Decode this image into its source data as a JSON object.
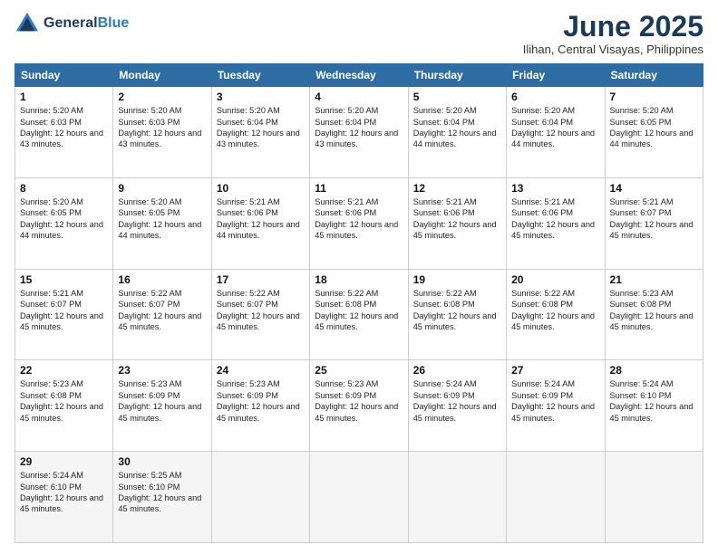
{
  "header": {
    "logo_line1": "General",
    "logo_line2": "Blue",
    "month": "June 2025",
    "location": "Ilihan, Central Visayas, Philippines"
  },
  "weekdays": [
    "Sunday",
    "Monday",
    "Tuesday",
    "Wednesday",
    "Thursday",
    "Friday",
    "Saturday"
  ],
  "weeks": [
    [
      {
        "day": "1",
        "rise": "5:20 AM",
        "set": "6:03 PM",
        "daylight": "12 hours and 43 minutes."
      },
      {
        "day": "2",
        "rise": "5:20 AM",
        "set": "6:03 PM",
        "daylight": "12 hours and 43 minutes."
      },
      {
        "day": "3",
        "rise": "5:20 AM",
        "set": "6:04 PM",
        "daylight": "12 hours and 43 minutes."
      },
      {
        "day": "4",
        "rise": "5:20 AM",
        "set": "6:04 PM",
        "daylight": "12 hours and 43 minutes."
      },
      {
        "day": "5",
        "rise": "5:20 AM",
        "set": "6:04 PM",
        "daylight": "12 hours and 44 minutes."
      },
      {
        "day": "6",
        "rise": "5:20 AM",
        "set": "6:04 PM",
        "daylight": "12 hours and 44 minutes."
      },
      {
        "day": "7",
        "rise": "5:20 AM",
        "set": "6:05 PM",
        "daylight": "12 hours and 44 minutes."
      }
    ],
    [
      {
        "day": "8",
        "rise": "5:20 AM",
        "set": "6:05 PM",
        "daylight": "12 hours and 44 minutes."
      },
      {
        "day": "9",
        "rise": "5:20 AM",
        "set": "6:05 PM",
        "daylight": "12 hours and 44 minutes."
      },
      {
        "day": "10",
        "rise": "5:21 AM",
        "set": "6:06 PM",
        "daylight": "12 hours and 44 minutes."
      },
      {
        "day": "11",
        "rise": "5:21 AM",
        "set": "6:06 PM",
        "daylight": "12 hours and 45 minutes."
      },
      {
        "day": "12",
        "rise": "5:21 AM",
        "set": "6:06 PM",
        "daylight": "12 hours and 45 minutes."
      },
      {
        "day": "13",
        "rise": "5:21 AM",
        "set": "6:06 PM",
        "daylight": "12 hours and 45 minutes."
      },
      {
        "day": "14",
        "rise": "5:21 AM",
        "set": "6:07 PM",
        "daylight": "12 hours and 45 minutes."
      }
    ],
    [
      {
        "day": "15",
        "rise": "5:21 AM",
        "set": "6:07 PM",
        "daylight": "12 hours and 45 minutes."
      },
      {
        "day": "16",
        "rise": "5:22 AM",
        "set": "6:07 PM",
        "daylight": "12 hours and 45 minutes."
      },
      {
        "day": "17",
        "rise": "5:22 AM",
        "set": "6:07 PM",
        "daylight": "12 hours and 45 minutes."
      },
      {
        "day": "18",
        "rise": "5:22 AM",
        "set": "6:08 PM",
        "daylight": "12 hours and 45 minutes."
      },
      {
        "day": "19",
        "rise": "5:22 AM",
        "set": "6:08 PM",
        "daylight": "12 hours and 45 minutes."
      },
      {
        "day": "20",
        "rise": "5:22 AM",
        "set": "6:08 PM",
        "daylight": "12 hours and 45 minutes."
      },
      {
        "day": "21",
        "rise": "5:23 AM",
        "set": "6:08 PM",
        "daylight": "12 hours and 45 minutes."
      }
    ],
    [
      {
        "day": "22",
        "rise": "5:23 AM",
        "set": "6:08 PM",
        "daylight": "12 hours and 45 minutes."
      },
      {
        "day": "23",
        "rise": "5:23 AM",
        "set": "6:09 PM",
        "daylight": "12 hours and 45 minutes."
      },
      {
        "day": "24",
        "rise": "5:23 AM",
        "set": "6:09 PM",
        "daylight": "12 hours and 45 minutes."
      },
      {
        "day": "25",
        "rise": "5:23 AM",
        "set": "6:09 PM",
        "daylight": "12 hours and 45 minutes."
      },
      {
        "day": "26",
        "rise": "5:24 AM",
        "set": "6:09 PM",
        "daylight": "12 hours and 45 minutes."
      },
      {
        "day": "27",
        "rise": "5:24 AM",
        "set": "6:09 PM",
        "daylight": "12 hours and 45 minutes."
      },
      {
        "day": "28",
        "rise": "5:24 AM",
        "set": "6:10 PM",
        "daylight": "12 hours and 45 minutes."
      }
    ],
    [
      {
        "day": "29",
        "rise": "5:24 AM",
        "set": "6:10 PM",
        "daylight": "12 hours and 45 minutes."
      },
      {
        "day": "30",
        "rise": "5:25 AM",
        "set": "6:10 PM",
        "daylight": "12 hours and 45 minutes."
      },
      null,
      null,
      null,
      null,
      null
    ]
  ]
}
